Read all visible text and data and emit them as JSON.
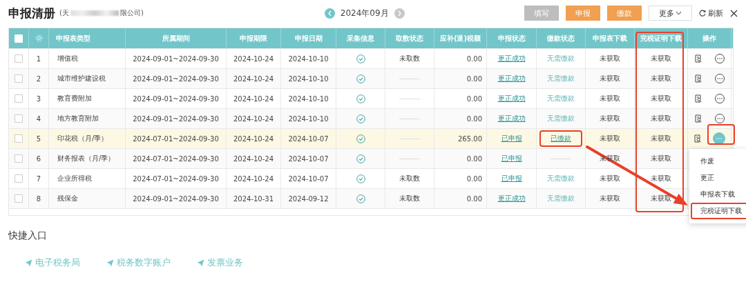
{
  "header": {
    "title": "申报清册",
    "company_prefix": "(天",
    "company_suffix": "限公司)"
  },
  "month_nav": {
    "label": "2024年09月"
  },
  "toolbar": {
    "buttons": [
      {
        "label": "填写",
        "kind": "disabled"
      },
      {
        "label": "申报",
        "kind": "primary"
      },
      {
        "label": "缴款",
        "kind": "primary"
      },
      {
        "label": "更多",
        "kind": "dropdown"
      }
    ],
    "refresh": "刷新"
  },
  "table": {
    "header_checked": false,
    "columns": [
      {
        "label": "申报表类型",
        "annotated": false
      },
      {
        "label": "所属期间",
        "annotated": false
      },
      {
        "label": "申报期限",
        "annotated": false
      },
      {
        "label": "申报日期",
        "annotated": false
      },
      {
        "label": "采集信息",
        "annotated": false
      },
      {
        "label": "取数状态",
        "annotated": false
      },
      {
        "label": "应补(退)税额",
        "annotated": false
      },
      {
        "label": "申报状态",
        "annotated": false
      },
      {
        "label": "缴款状态",
        "annotated": false
      },
      {
        "label": "申报表下载",
        "annotated": false
      },
      {
        "label": "完税证明下载",
        "annotated": true
      },
      {
        "label": "操作",
        "annotated": false
      }
    ],
    "rows": [
      {
        "checked": false,
        "index": "1",
        "type": "增值税",
        "period": "2024-09-01~2024-09-30",
        "deadline": "2024-10-24",
        "date": "2024-10-10",
        "collected": true,
        "fetch": "未取数",
        "amount": "0.00",
        "filing": "更正成功",
        "payment": "无需缴款",
        "payment_linked": false,
        "payment_annotated": false,
        "report_dl": "未获取",
        "cert_dl": "未获取",
        "actions_shown": true,
        "menu_open": false,
        "selected": false
      },
      {
        "checked": false,
        "index": "2",
        "type": "城市维护建设税",
        "period": "2024-09-01~2024-09-30",
        "deadline": "2024-10-24",
        "date": "2024-10-10",
        "collected": true,
        "amount": "0.00",
        "filing": "更正成功",
        "payment": "无需缴款",
        "payment_linked": false,
        "payment_annotated": false,
        "report_dl": "未获取",
        "cert_dl": "未获取",
        "actions_shown": true,
        "menu_open": false,
        "selected": false
      },
      {
        "checked": false,
        "index": "3",
        "type": "教育费附加",
        "period": "2024-09-01~2024-09-30",
        "deadline": "2024-10-24",
        "date": "2024-10-10",
        "collected": true,
        "amount": "0.00",
        "filing": "更正成功",
        "payment": "无需缴款",
        "payment_linked": false,
        "payment_annotated": false,
        "report_dl": "未获取",
        "cert_dl": "未获取",
        "actions_shown": true,
        "menu_open": false,
        "selected": false
      },
      {
        "checked": false,
        "index": "4",
        "type": "地方教育附加",
        "period": "2024-09-01~2024-09-30",
        "deadline": "2024-10-24",
        "date": "2024-10-10",
        "collected": true,
        "amount": "0.00",
        "filing": "更正成功",
        "payment": "无需缴款",
        "payment_linked": false,
        "payment_annotated": false,
        "report_dl": "未获取",
        "cert_dl": "未获取",
        "actions_shown": true,
        "menu_open": false,
        "selected": false
      },
      {
        "checked": false,
        "index": "5",
        "type": "印花税（月/季）",
        "period": "2024-07-01~2024-09-30",
        "deadline": "2024-10-24",
        "date": "2024-10-07",
        "collected": true,
        "amount": "265.00",
        "filing": "已申报",
        "payment": "已缴款",
        "payment_linked": true,
        "payment_annotated": true,
        "report_dl": "未获取",
        "cert_dl": "未获取",
        "actions_shown": true,
        "menu_open": true,
        "selected": true
      },
      {
        "checked": false,
        "index": "6",
        "type": "财务报表（月/季）",
        "period": "2024-07-01~2024-09-30",
        "deadline": "2024-10-24",
        "date": "2024-10-07",
        "collected": true,
        "amount": "0.00",
        "filing": "已申报",
        "payment_annotated": false,
        "report_dl": "未获取",
        "cert_dl": "未获取",
        "actions_shown": false,
        "menu_open": false,
        "selected": false
      },
      {
        "checked": false,
        "index": "7",
        "type": "企业所得税",
        "period": "2024-07-01~2024-09-30",
        "deadline": "2024-10-24",
        "date": "2024-10-07",
        "collected": true,
        "fetch": "未取数",
        "amount": "0.00",
        "filing": "已申报",
        "payment": "无需缴款",
        "payment_linked": false,
        "payment_annotated": false,
        "report_dl": "未获取",
        "cert_dl": "未获取",
        "actions_shown": false,
        "menu_open": false,
        "selected": false
      },
      {
        "checked": false,
        "index": "8",
        "type": "残保金",
        "period": "2024-09-01~2024-09-30",
        "deadline": "2024-10-31",
        "date": "2024-09-12",
        "collected": true,
        "fetch": "未取数",
        "amount": "0.00",
        "filing": "更正成功",
        "payment": "无需缴款",
        "payment_linked": false,
        "payment_annotated": false,
        "report_dl": "未获取",
        "cert_dl": "未获取",
        "actions_shown": false,
        "menu_open": false,
        "selected": false
      }
    ]
  },
  "menu": {
    "items": [
      {
        "label": "作废",
        "annotated": false
      },
      {
        "label": "更正",
        "annotated": false
      },
      {
        "label": "申报表下载",
        "annotated": false
      },
      {
        "label": "完税证明下载",
        "annotated": true
      }
    ]
  },
  "quick_entry": {
    "title": "快捷入口",
    "links": [
      "电子税务局",
      "税务数字账户",
      "发票业务"
    ]
  }
}
